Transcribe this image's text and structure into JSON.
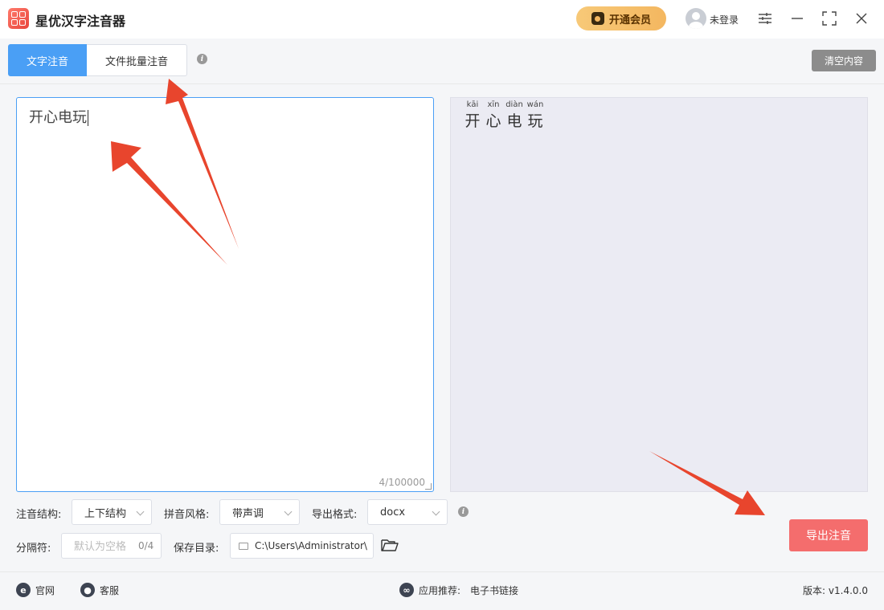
{
  "app": {
    "title": "星优汉字注音器"
  },
  "header": {
    "vip_label": "开通会员",
    "login_label": "未登录"
  },
  "tabs": [
    {
      "label": "文字注音",
      "active": true
    },
    {
      "label": "文件批量注音",
      "active": false
    }
  ],
  "toolbar": {
    "clear_label": "清空内容"
  },
  "editor": {
    "input_text": "开心电玩",
    "char_count": "4/100000"
  },
  "output": {
    "ruby": [
      {
        "pinyin": "kāi",
        "hanzi": "开"
      },
      {
        "pinyin": "xīn",
        "hanzi": "心"
      },
      {
        "pinyin": "diàn",
        "hanzi": "电"
      },
      {
        "pinyin": "wán",
        "hanzi": "玩"
      }
    ]
  },
  "options": {
    "structure_label": "注音结构:",
    "structure_value": "上下结构",
    "style_label": "拼音风格:",
    "style_value": "带声调",
    "format_label": "导出格式:",
    "format_value": "docx",
    "separator_label": "分隔符:",
    "separator_placeholder": "默认为空格",
    "separator_count": "0/4",
    "save_label": "保存目录:",
    "save_path": "C:\\Users\\Administrator\\"
  },
  "actions": {
    "export_label": "导出注音"
  },
  "footer": {
    "website_label": "官网",
    "service_label": "客服",
    "recommend_label": "应用推荐:",
    "recommend_link": "电子书链接",
    "version": "版本: v1.4.0.0"
  },
  "colors": {
    "accent": "#4a9ff5",
    "export": "#f46d6d",
    "arrow": "#e8452d",
    "vip": "#f4b760"
  }
}
